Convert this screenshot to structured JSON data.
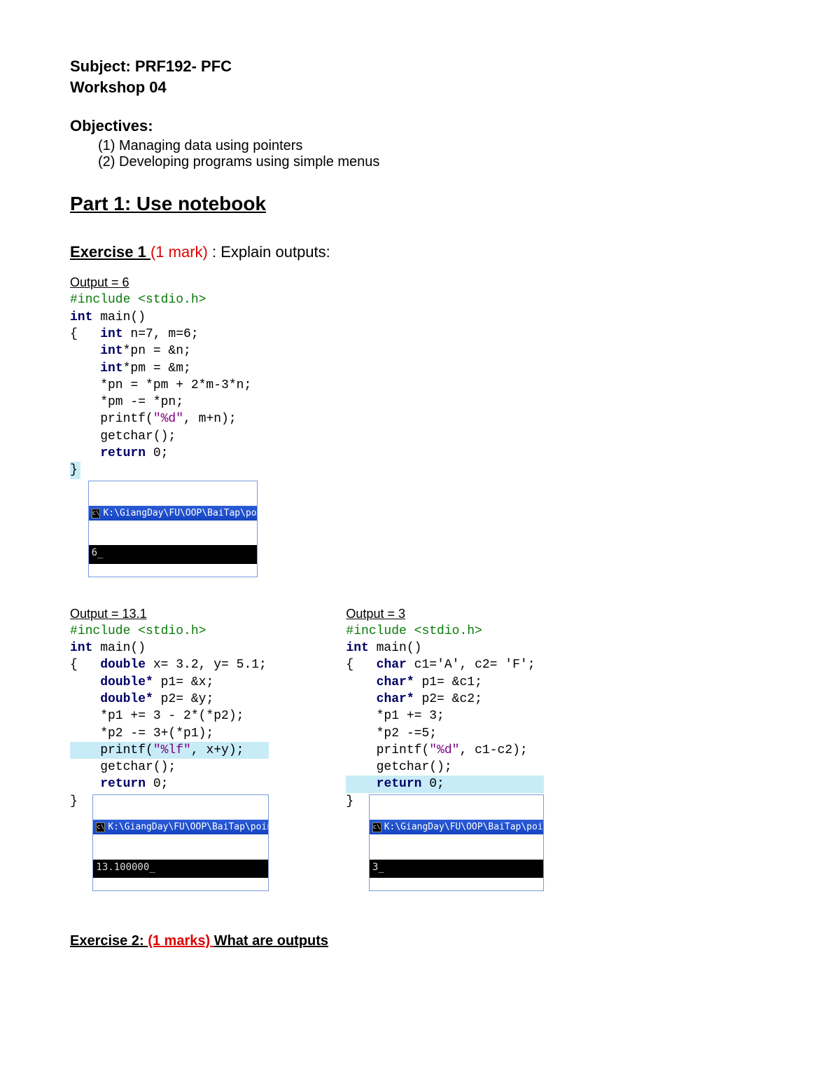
{
  "header": {
    "line1": "Subject: PRF192- PFC",
    "line2": "Workshop 04"
  },
  "objectives": {
    "heading": "Objectives:",
    "items": [
      "(1) Managing data using pointers",
      "(2) Developing programs using simple menus"
    ]
  },
  "part1_title": "Part 1: Use notebook",
  "exercise1": {
    "label": "Exercise 1 ",
    "marks": "(1 mark)",
    "rest": " : Explain outputs:"
  },
  "snippet1": {
    "output_label": "Output = 6",
    "pp": "#include <stdio.h>",
    "l1a": "int",
    "l1b": " main()",
    "l2a": "{   ",
    "l2b": "int",
    "l2c": " n=7, m=6;",
    "l3a": "    ",
    "l3b": "int",
    "l3c": "*pn = &n;",
    "l4a": "    ",
    "l4b": "int",
    "l4c": "*pm = &m;",
    "l5": "    *pn = *pm + 2*m-3*n;",
    "l6": "    *pm -= *pn;",
    "l7a": "    printf(",
    "l7s": "\"%d\"",
    "l7b": ", m+n);",
    "l8": "    getchar();",
    "l9a": "    ",
    "l9b": "return",
    "l9c": " 0;",
    "l10": "}",
    "console_title": "K:\\GiangDay\\FU\\OOP\\BaiTap\\poin",
    "console_out": "6_"
  },
  "snippet2": {
    "output_label": "Output = 13.1",
    "pp": "#include <stdio.h>",
    "l1a": "int",
    "l1b": " main()",
    "l2a": "{   ",
    "l2b": "double",
    "l2c": " x= 3.2, y= 5.1;",
    "l3a": "    ",
    "l3b": "double*",
    "l3c": " p1= &x;",
    "l4a": "    ",
    "l4b": "double*",
    "l4c": " p2= &y;",
    "l5": "    *p1 += 3 - 2*(*p2);",
    "l6": "    *p2 -= 3+(*p1);",
    "l7a": "    printf(",
    "l7s": "\"%lf\"",
    "l7b": ", x+y);",
    "l8": "    getchar();",
    "l9a": "    ",
    "l9b": "return",
    "l9c": " 0;",
    "l10": "}",
    "console_title": "K:\\GiangDay\\FU\\OOP\\BaiTap\\pointer",
    "console_out": "13.100000_"
  },
  "snippet3": {
    "output_label": "Output = 3",
    "pp": "#include <stdio.h>",
    "l1a": "int",
    "l1b": " main()",
    "l2a": "{   ",
    "l2b": "char",
    "l2c": " c1='A', c2= 'F';",
    "l3a": "    ",
    "l3b": "char*",
    "l3c": " p1= &c1;",
    "l4a": "    ",
    "l4b": "char*",
    "l4c": " p2= &c2;",
    "l5": "    *p1 += 3;",
    "l6": "    *p2 -=5;",
    "l7a": "    printf(",
    "l7s": "\"%d\"",
    "l7b": ", c1-c2);",
    "l8": "    getchar();",
    "l9a": "    ",
    "l9b": "return",
    "l9c": " 0;",
    "l10": "}",
    "console_title": "K:\\GiangDay\\FU\\OOP\\BaiTap\\pointe",
    "console_out": "3_"
  },
  "exercise2": {
    "label": "Exercise 2: ",
    "marks": "(1 marks) ",
    "rest": "What are outputs"
  }
}
